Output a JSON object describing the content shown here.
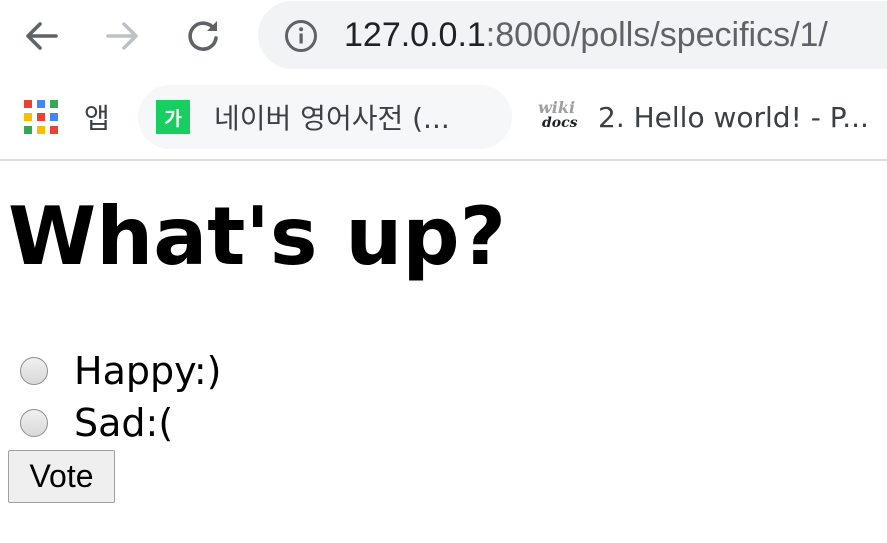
{
  "browser": {
    "back_icon": "arrow-left-icon",
    "forward_icon": "arrow-right-icon",
    "reload_icon": "reload-icon",
    "url_host": "127.0.0.1",
    "url_rest": ":8000/polls/specifics/1/",
    "site_info_icon": "info-icon"
  },
  "bookmarks": {
    "apps_label": "앱",
    "items": [
      {
        "label": "네이버 영어사전 (...",
        "icon": "naver-dictionary-icon",
        "icon_text": "가"
      },
      {
        "label": "2. Hello world! - P...",
        "icon": "wikidocs-icon",
        "icon_text_top": "wiki",
        "icon_text_bottom": "docs"
      }
    ]
  },
  "page": {
    "title": "What's up?",
    "choices": [
      {
        "label": "Happy:)",
        "checked": false
      },
      {
        "label": "Sad:(",
        "checked": false
      }
    ],
    "vote_label": "Vote"
  },
  "colors": {
    "omnibox_bg": "#f1f3f4",
    "naver_green": "#19ce60",
    "apps_grid": [
      "#ea4335",
      "#4285f4",
      "#fbbc04",
      "#34a853"
    ]
  }
}
